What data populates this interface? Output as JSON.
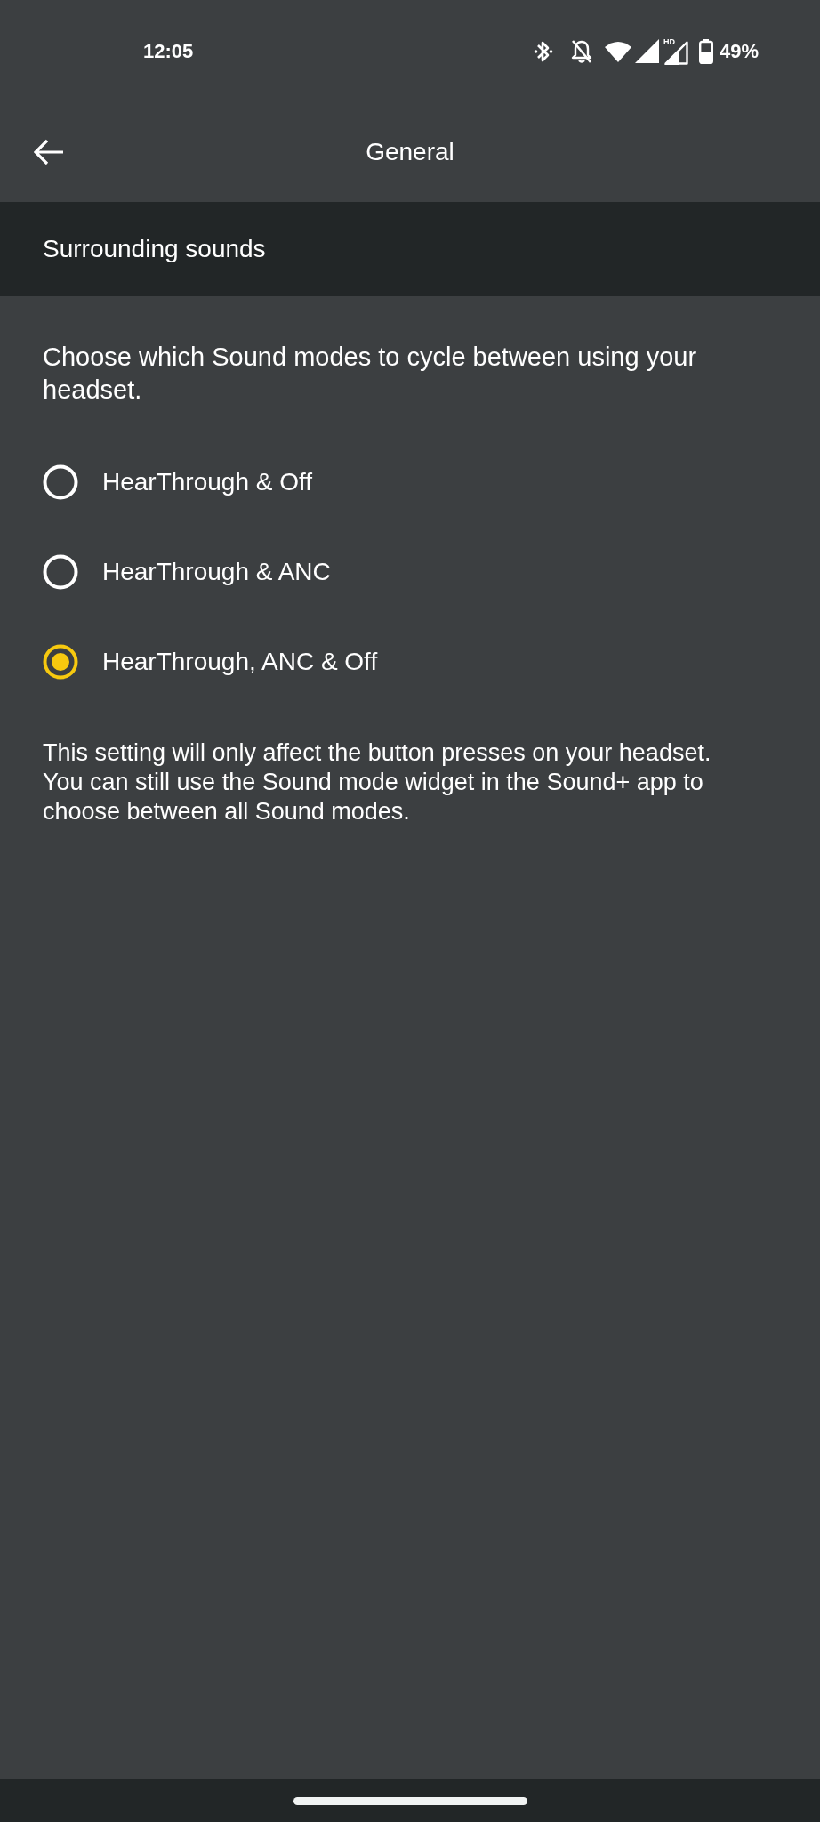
{
  "status_bar": {
    "time": "12:05",
    "signal_badge": "HD",
    "battery": "49%"
  },
  "app_bar": {
    "title": "General"
  },
  "section": {
    "title": "Surrounding sounds"
  },
  "description": "Choose which Sound modes to cycle between using your headset.",
  "options": [
    {
      "label": "HearThrough & Off",
      "selected": false
    },
    {
      "label": "HearThrough & ANC",
      "selected": false
    },
    {
      "label": "HearThrough, ANC & Off",
      "selected": true
    }
  ],
  "note": "This setting will only affect the button presses on your headset. You can still use the Sound mode widget in the Sound+ app to choose between all Sound modes."
}
